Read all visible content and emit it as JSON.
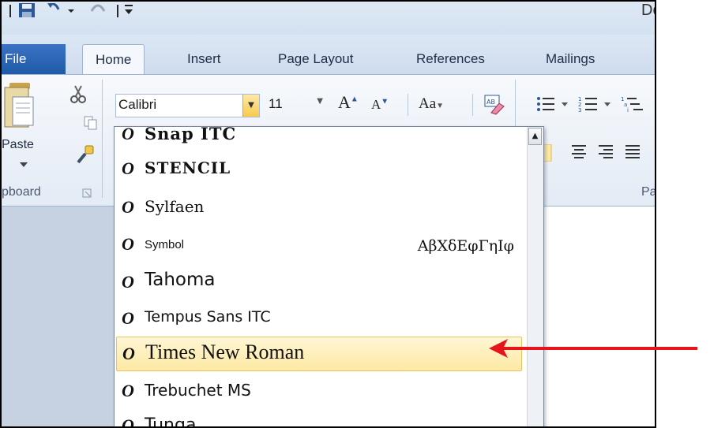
{
  "title_bar": {
    "title_fragment": "Do"
  },
  "tabs": {
    "file": "File",
    "items": [
      {
        "label": "Home",
        "active": true
      },
      {
        "label": "Insert"
      },
      {
        "label": "Page Layout"
      },
      {
        "label": "References"
      },
      {
        "label": "Mailings"
      }
    ]
  },
  "ribbon": {
    "clipboard": {
      "paste_label": "Paste",
      "group_label": "pboard"
    },
    "font": {
      "name": "Calibri",
      "size": "11",
      "change_case": "Aa"
    },
    "paragraph": {
      "group_label": "Pa"
    }
  },
  "font_list": {
    "items": [
      {
        "name": "Snap ITC",
        "style": "snap"
      },
      {
        "name": "STENCIL",
        "style": "stencil"
      },
      {
        "name": "Sylfaen",
        "style": "sylfaen"
      },
      {
        "name": "Symbol",
        "style": "symbol",
        "sample": "ΑβΧδΕφΓηΙφ"
      },
      {
        "name": "Tahoma",
        "style": "tahoma"
      },
      {
        "name": "Tempus Sans ITC",
        "style": "tempus"
      },
      {
        "name": "Times New Roman",
        "style": "times",
        "highlighted": true
      },
      {
        "name": "Trebuchet MS",
        "style": "trebuchet"
      },
      {
        "name": "Tunga",
        "style": "tunga"
      }
    ]
  },
  "colors": {
    "file_tab": "#2a63b5",
    "highlight": "#fde9a3",
    "arrow": "#e8141b"
  }
}
